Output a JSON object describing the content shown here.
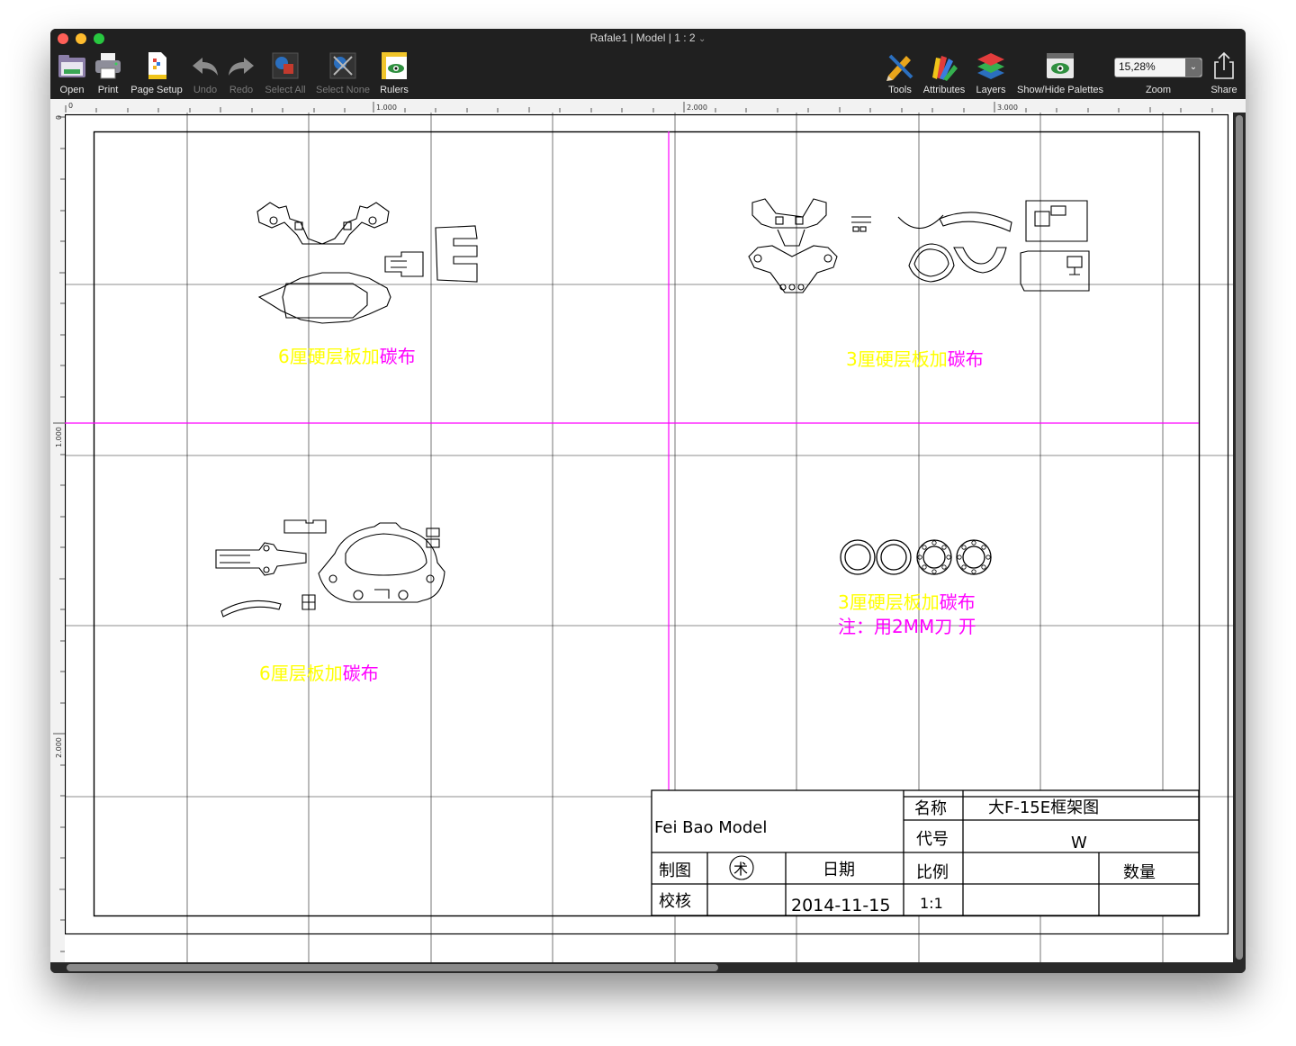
{
  "window": {
    "title": "Rafale1 | Model | 1 : 2",
    "title_chevron": "⌄"
  },
  "toolbar": {
    "open": "Open",
    "print": "Print",
    "page_setup": "Page Setup",
    "undo": "Undo",
    "redo": "Redo",
    "select_all": "Select All",
    "select_none": "Select None",
    "rulers": "Rulers",
    "tools": "Tools",
    "attributes": "Attributes",
    "layers": "Layers",
    "show_hide": "Show/Hide Palettes",
    "zoom_value": "15,28%",
    "zoom_label": "Zoom",
    "share": "Share"
  },
  "rulers": {
    "h_labels": [
      "0",
      "1.000",
      "2.000",
      "3.000"
    ],
    "v_labels": [
      "0",
      "1.000",
      "2.000"
    ]
  },
  "drawing": {
    "panel_tl_material_a": "6厘硬层板加",
    "panel_tl_material_b": "碳布",
    "panel_tr_material_a": "3厘硬层板加",
    "panel_tr_material_b": "碳布",
    "panel_bl_material_a": "6厘层板加",
    "panel_bl_material_b": "碳布",
    "panel_br_material_a": "3厘硬层板加",
    "panel_br_material_b": "碳布",
    "panel_br_note": "注：用2MM刀 开"
  },
  "title_block": {
    "company": "Fei Bao  Model",
    "name_label": "名称",
    "name_value": "大F-15E框架图",
    "code_label": "代号",
    "code_value": "W",
    "drawn_label": "制图",
    "drawn_stamp": "术",
    "date_label": "日期",
    "scale_label": "比例",
    "quantity_label": "数量",
    "check_label": "校核",
    "date_value": "2014-11-15",
    "scale_value": "1:1"
  },
  "colors": {
    "yellow_text": "#ffff00",
    "magenta_text": "#ff00ff",
    "guide_line": "#ff00ff",
    "toolbar_bg": "#202020"
  }
}
